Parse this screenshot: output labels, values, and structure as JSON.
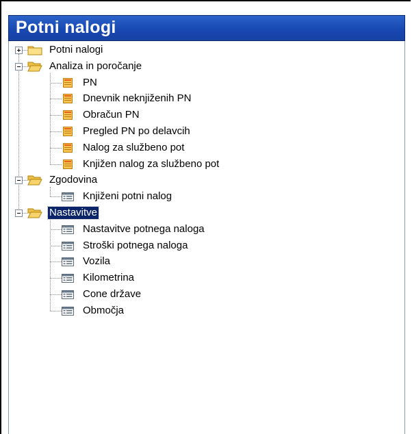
{
  "window": {
    "title": "Potni nalogi"
  },
  "tree": [
    {
      "label": "Potni nalogi",
      "type": "folder",
      "state": "collapsed",
      "children": []
    },
    {
      "label": "Analiza in poročanje",
      "type": "folder",
      "state": "expanded",
      "children": [
        {
          "label": "PN",
          "type": "report"
        },
        {
          "label": "Dnevnik neknjiženih PN",
          "type": "report"
        },
        {
          "label": "Obračun PN",
          "type": "report"
        },
        {
          "label": "Pregled PN po delavcih",
          "type": "report"
        },
        {
          "label": "Nalog za službeno pot",
          "type": "report"
        },
        {
          "label": "Knjižen nalog za službeno pot",
          "type": "report"
        }
      ]
    },
    {
      "label": "Zgodovina",
      "type": "folder",
      "state": "expanded",
      "children": [
        {
          "label": "Knjiženi potni nalog",
          "type": "form"
        }
      ]
    },
    {
      "label": "Nastavitve",
      "type": "folder",
      "state": "expanded",
      "selected": true,
      "children": [
        {
          "label": "Nastavitve potnega naloga",
          "type": "form"
        },
        {
          "label": "Stroški potnega naloga",
          "type": "form"
        },
        {
          "label": "Vozila",
          "type": "form"
        },
        {
          "label": "Kilometrina",
          "type": "form"
        },
        {
          "label": "Cone države",
          "type": "form"
        },
        {
          "label": "Območja",
          "type": "form"
        }
      ]
    }
  ],
  "colors": {
    "header": "#1849b2",
    "selection": "#0a246a",
    "folder": "#f7d36b",
    "report_icon": "#e8a020",
    "form_icon": "#6b7b8c"
  },
  "icons": {
    "folder_closed": "folder-icon",
    "folder_open": "folder-open-icon",
    "report": "report-icon",
    "form": "form-icon",
    "expand": "expand-plus-icon",
    "collapse": "collapse-minus-icon"
  }
}
